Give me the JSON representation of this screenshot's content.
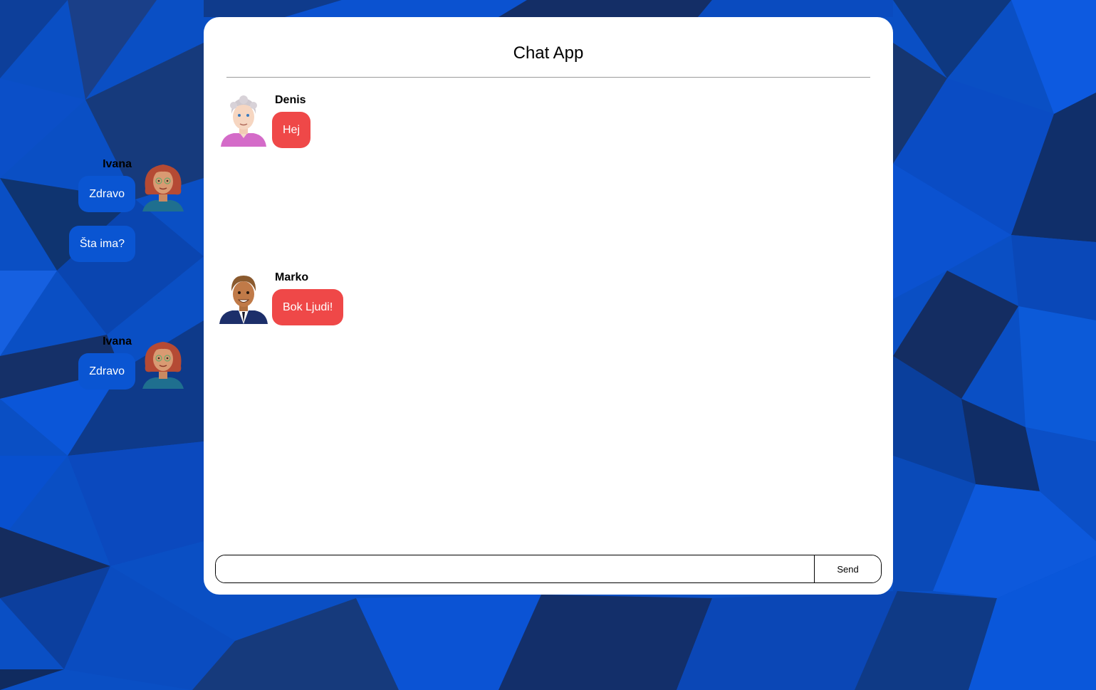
{
  "app": {
    "title": "Chat App"
  },
  "colors": {
    "incoming_bubble": "#ef4848",
    "outgoing_bubble": "#0a55d2",
    "background": "#0a4fc4"
  },
  "messages": [
    {
      "sender": "Denis",
      "text": "Hej",
      "side": "left",
      "avatar": "elderly-man-avatar"
    },
    {
      "sender": "Ivana",
      "text": "Zdravo",
      "side": "right",
      "avatar": "red-haired-woman-avatar"
    },
    {
      "sender": "",
      "text": "Šta ima?",
      "side": "right",
      "avatar": ""
    },
    {
      "sender": "Marko",
      "text": "Bok Ljudi!",
      "side": "left",
      "avatar": "businessman-avatar"
    },
    {
      "sender": "Ivana",
      "text": "Zdravo",
      "side": "right",
      "avatar": "red-haired-woman-avatar"
    }
  ],
  "composer": {
    "input_value": "",
    "placeholder": "",
    "send_label": "Send"
  }
}
